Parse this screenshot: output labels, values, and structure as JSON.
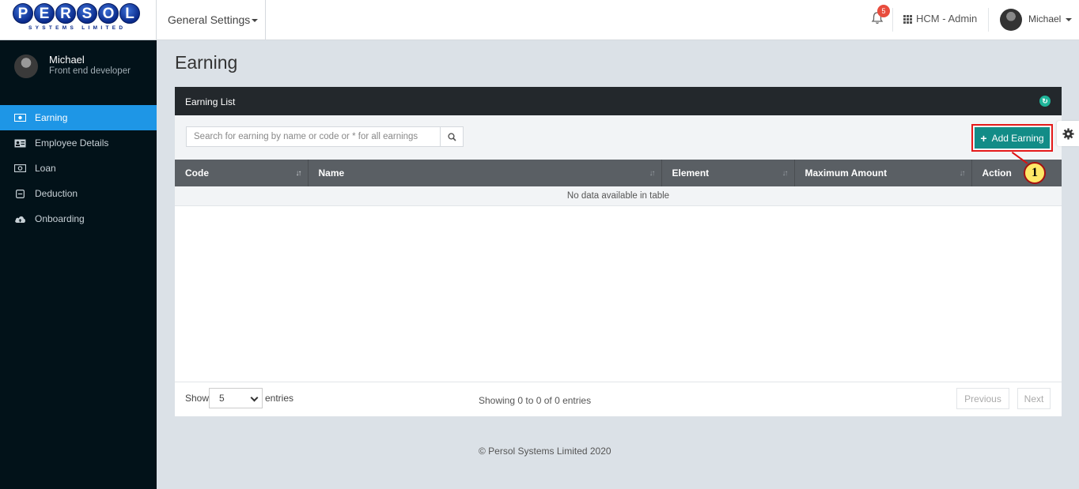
{
  "header": {
    "logo_text": "PERSOL",
    "logo_letters": [
      "P",
      "E",
      "R",
      "S",
      "O",
      "L"
    ],
    "logo_subtext": "SYSTEMS LIMITED",
    "settings_menu": "General Settings",
    "notification_count": "5",
    "app_switch": "HCM - Admin",
    "user_name": "Michael"
  },
  "sidebar": {
    "profile_name": "Michael",
    "profile_role": "Front end developer",
    "items": [
      {
        "label": "Earning",
        "icon": "money-icon",
        "active": true
      },
      {
        "label": "Employee Details",
        "icon": "id-card-icon",
        "active": false
      },
      {
        "label": "Loan",
        "icon": "cash-icon",
        "active": false
      },
      {
        "label": "Deduction",
        "icon": "minus-square-icon",
        "active": false
      },
      {
        "label": "Onboarding",
        "icon": "cloud-upload-icon",
        "active": false
      }
    ]
  },
  "main": {
    "page_title": "Earning",
    "panel_title": "Earning List",
    "search_placeholder": "Search for earning by name or code or * for all earnings",
    "add_button": "Add Earning",
    "table": {
      "columns": [
        "Code",
        "Name",
        "Element",
        "Maximum Amount",
        "Action"
      ],
      "empty_message": "No data available in table"
    },
    "footer": {
      "show_label": "Show",
      "entries_value": "5",
      "entries_label": "entries",
      "info": "Showing 0 to 0 of 0 entries",
      "previous": "Previous",
      "next": "Next"
    }
  },
  "copyright": "© Persol Systems Limited 2020",
  "callout_number": "1",
  "colors": {
    "sidebar_bg": "#021219",
    "active_nav": "#1e96e6",
    "add_button": "#128c87",
    "panel_header": "#23282c",
    "callout_border": "#e51a1a"
  }
}
